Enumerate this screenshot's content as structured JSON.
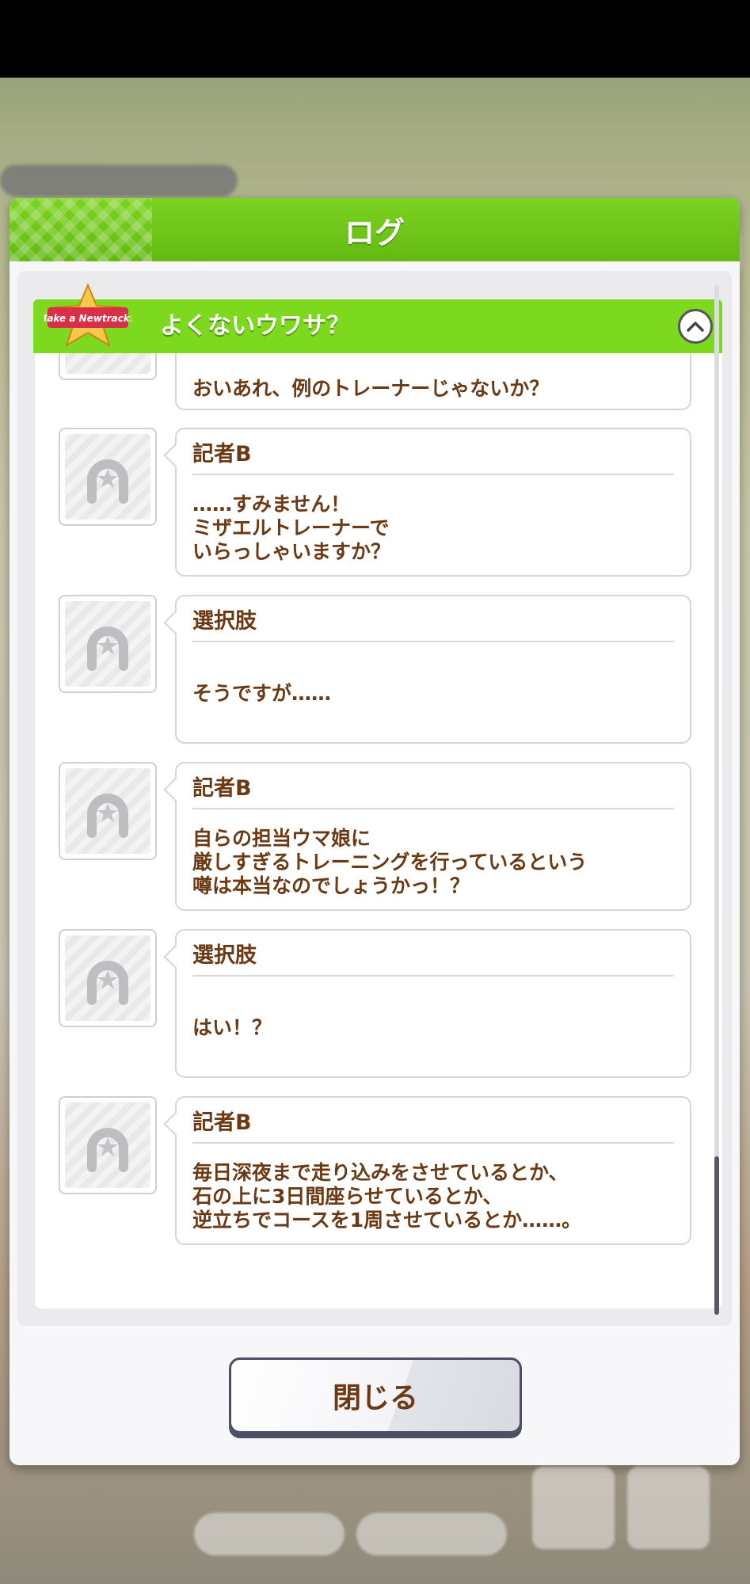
{
  "modal": {
    "title": "ログ"
  },
  "event": {
    "title": "よくないウワサ？",
    "badge_text": "Make a Newtrack!!"
  },
  "entries": [
    {
      "speaker": "",
      "text": "おいあれ、例のトレーナーじゃないか？"
    },
    {
      "speaker": "記者B",
      "text": "……すみません！\nミザエルトレーナーで\nいらっしゃいますか？"
    },
    {
      "speaker": "選択肢",
      "text": "そうですが……"
    },
    {
      "speaker": "記者B",
      "text": "自らの担当ウマ娘に\n厳しすぎるトレーニングを行っているという\n噂は本当なのでしょうかっ！？"
    },
    {
      "speaker": "選択肢",
      "text": "はい！？"
    },
    {
      "speaker": "記者B",
      "text": "毎日深夜まで走り込みをさせているとか、\n石の上に3日間座らせているとか、\n逆立ちでコースを1周させているとか……。"
    }
  ],
  "close_button": {
    "label": "閉じる"
  },
  "colors": {
    "header_green": "#7cd91e",
    "text_brown": "#6b3a14"
  },
  "icons": {
    "avatar": "horseshoe-star-icon",
    "collapse": "chevron-up-icon"
  }
}
